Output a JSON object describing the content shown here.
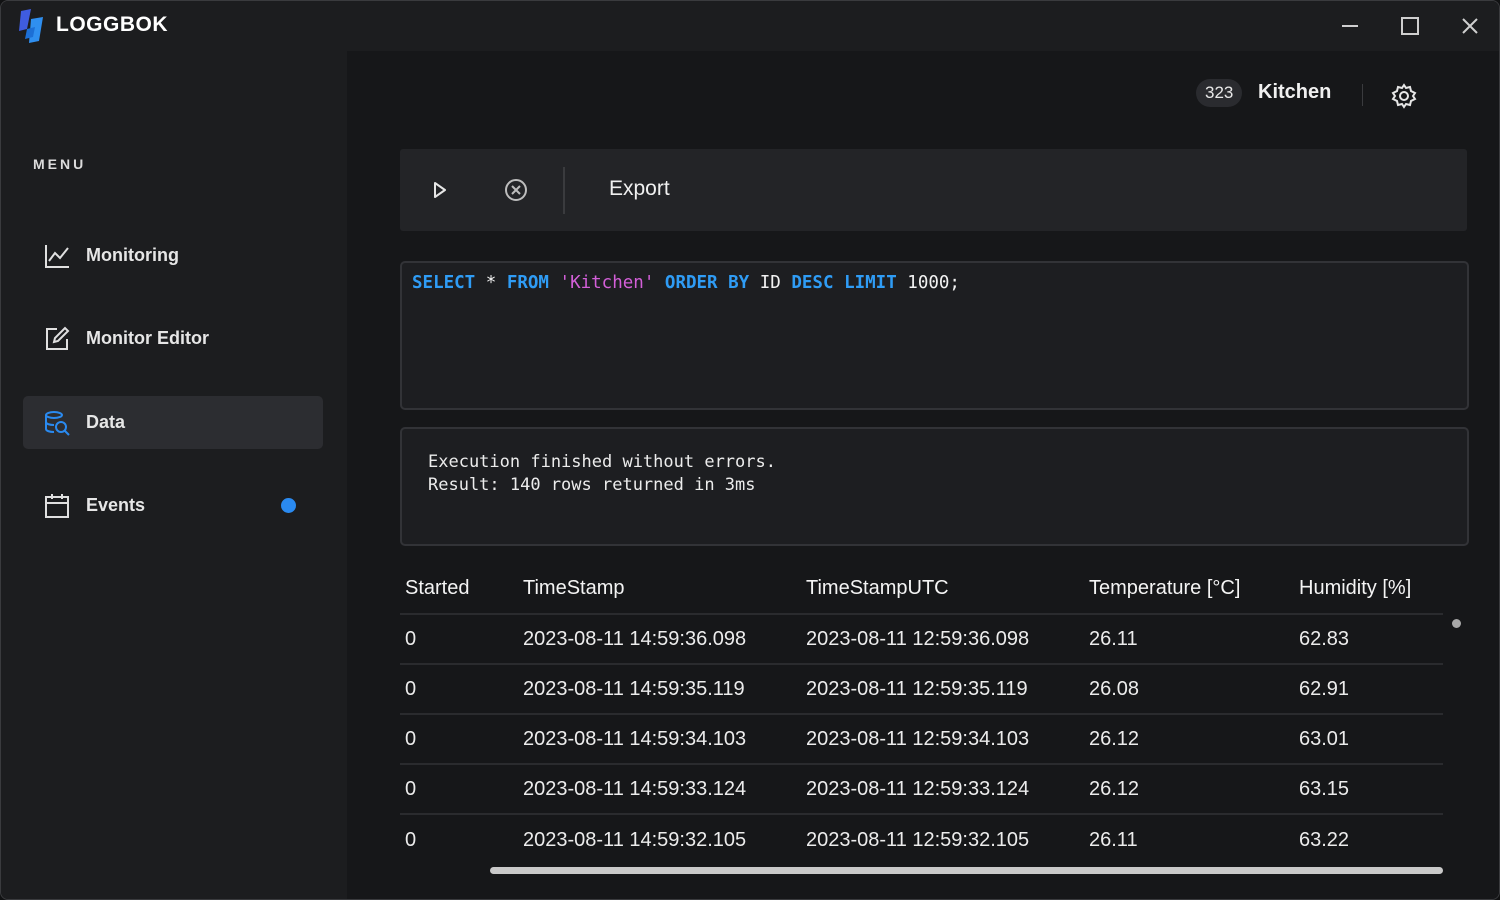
{
  "app": {
    "title": "LOGGBOK"
  },
  "window_controls": {
    "minimize_icon": "minimize-icon",
    "maximize_icon": "maximize-icon",
    "close_icon": "close-icon"
  },
  "sidebar": {
    "menu_title": "MENU",
    "items": [
      {
        "label": "Monitoring",
        "icon": "line-chart-icon",
        "active": false
      },
      {
        "label": "Monitor Editor",
        "icon": "edit-icon",
        "active": false
      },
      {
        "label": "Data",
        "icon": "database-search-icon",
        "active": true
      },
      {
        "label": "Events",
        "icon": "calendar-icon",
        "active": false,
        "notification": true
      }
    ]
  },
  "header": {
    "count": "323",
    "location": "Kitchen",
    "settings_icon": "gear-icon"
  },
  "toolbar": {
    "run_icon": "play-icon",
    "stop_icon": "cancel-circle-icon",
    "export_label": "Export"
  },
  "query": {
    "tokens": [
      {
        "t": "SELECT",
        "k": "kw"
      },
      {
        "t": " * ",
        "k": "plain"
      },
      {
        "t": "FROM",
        "k": "kw"
      },
      {
        "t": " ",
        "k": "plain"
      },
      {
        "t": "'Kitchen'",
        "k": "str"
      },
      {
        "t": " ",
        "k": "plain"
      },
      {
        "t": "ORDER BY",
        "k": "kw"
      },
      {
        "t": " ID ",
        "k": "plain"
      },
      {
        "t": "DESC",
        "k": "kw"
      },
      {
        "t": " ",
        "k": "plain"
      },
      {
        "t": "LIMIT",
        "k": "kw"
      },
      {
        "t": " 1000;",
        "k": "plain"
      }
    ]
  },
  "output": {
    "line1": "Execution finished without errors.",
    "line2": "Result: 140 rows returned in 3ms"
  },
  "table": {
    "columns": [
      "Started",
      "TimeStamp",
      "TimeStampUTC",
      "Temperature [°C]",
      "Humidity [%]"
    ],
    "rows": [
      [
        "0",
        "2023-08-11 14:59:36.098",
        "2023-08-11 12:59:36.098",
        "26.11",
        "62.83"
      ],
      [
        "0",
        "2023-08-11 14:59:35.119",
        "2023-08-11 12:59:35.119",
        "26.08",
        "62.91"
      ],
      [
        "0",
        "2023-08-11 14:59:34.103",
        "2023-08-11 12:59:34.103",
        "26.12",
        "63.01"
      ],
      [
        "0",
        "2023-08-11 14:59:33.124",
        "2023-08-11 12:59:33.124",
        "26.12",
        "63.15"
      ],
      [
        "0",
        "2023-08-11 14:59:32.105",
        "2023-08-11 12:59:32.105",
        "26.11",
        "63.22"
      ]
    ]
  },
  "colors": {
    "accent": "#2a8af0",
    "keyword": "#2f9cf5",
    "string": "#d35fd8"
  }
}
